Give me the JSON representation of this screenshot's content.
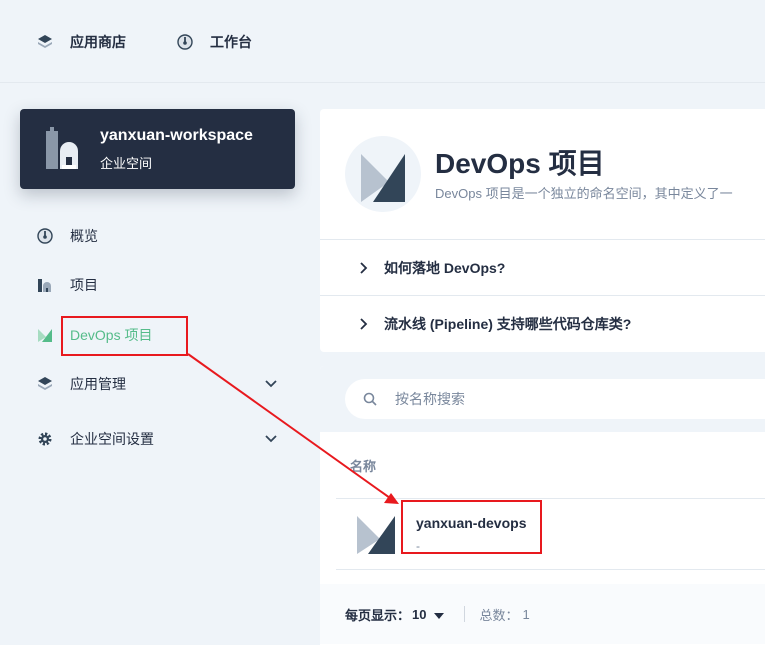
{
  "topbar": {
    "app_store": "应用商店",
    "workbench": "工作台"
  },
  "workspace": {
    "name": "yanxuan-workspace",
    "type": "企业空间"
  },
  "sidebar": {
    "items": [
      {
        "label": "概览",
        "icon": "dashboard-icon"
      },
      {
        "label": "项目",
        "icon": "project-icon"
      },
      {
        "label": "DevOps 项目",
        "icon": "devops-icon",
        "active": true
      },
      {
        "label": "应用管理",
        "icon": "appstore-icon",
        "expandable": true
      },
      {
        "label": "企业空间设置",
        "icon": "gear-icon",
        "expandable": true
      }
    ]
  },
  "header": {
    "title": "DevOps 项目",
    "description": "DevOps 项目是一个独立的命名空间，其中定义了一"
  },
  "faq": [
    {
      "question": "如何落地 DevOps?"
    },
    {
      "question": "流水线 (Pipeline) 支持哪些代码仓库类?"
    }
  ],
  "search": {
    "placeholder": "按名称搜索"
  },
  "table": {
    "columns": [
      "名称"
    ],
    "rows": [
      {
        "name": "yanxuan-devops",
        "description": "-"
      }
    ]
  },
  "pagination": {
    "per_page_label": "每页显示：",
    "per_page_value": "10",
    "total_label": "总数：",
    "total_value": "1"
  },
  "colors": {
    "accent": "#55bc8a",
    "dark": "#242e42",
    "annotation": "#e8191e"
  }
}
